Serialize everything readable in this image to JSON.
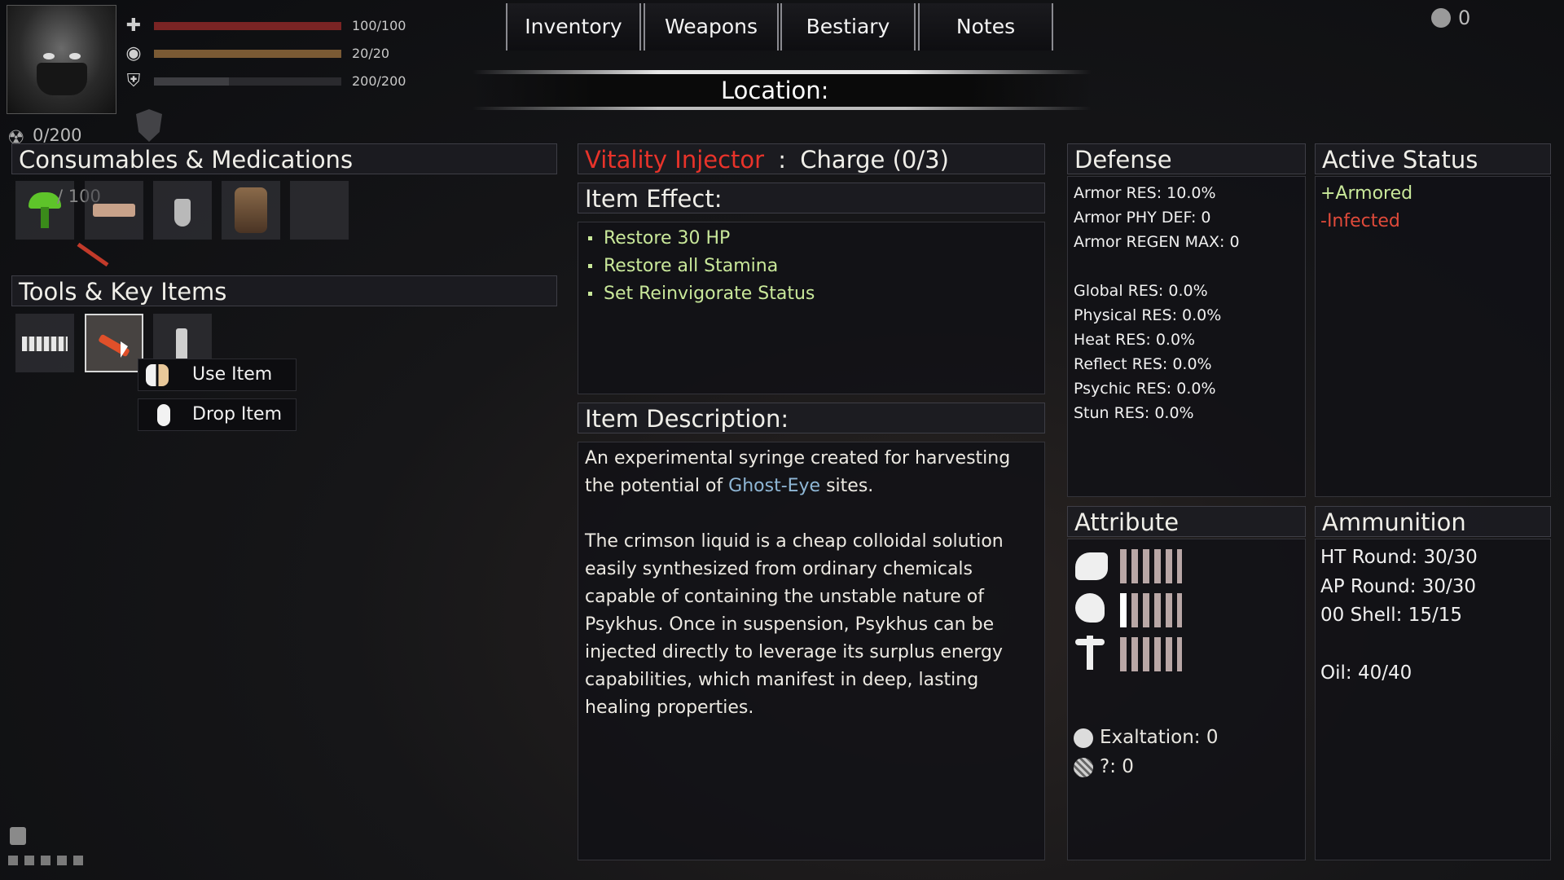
{
  "player": {
    "bars": [
      {
        "icon": "health-cross-icon",
        "value": "100/100",
        "color": "#7a2424",
        "fill": 1.0
      },
      {
        "icon": "eye-icon",
        "value": "20/20",
        "color": "#7a5a34",
        "fill": 1.0
      },
      {
        "icon": "shield-icon",
        "value": "200/200",
        "color": "#3e3e42",
        "fill": 0.4
      }
    ],
    "radiation": "0/200",
    "counter_top_right": "0"
  },
  "tabs": [
    "Inventory",
    "Weapons",
    "Bestiary",
    "Notes"
  ],
  "location_label": "Location:",
  "consumables": {
    "title": "Consumables & Medications",
    "partial_overlay": "/ 100"
  },
  "tools": {
    "title": "Tools & Key Items"
  },
  "context_menu": {
    "use": "Use Item",
    "drop": "Drop Item"
  },
  "item": {
    "name": "Vitality Injector",
    "separator": ":",
    "charge": "Charge (0/3)",
    "effect_title": "Item Effect:",
    "effects": [
      "Restore 30 HP",
      "Restore all Stamina",
      "Set Reinvigorate Status"
    ],
    "description_title": "Item Description:",
    "desc_p1_before": "An experimental syringe created for harvesting the potential of ",
    "desc_p1_highlight": "Ghost-Eye",
    "desc_p1_after": " sites.",
    "desc_p2": "The crimson liquid is a cheap colloidal solution easily synthesized from ordinary chemicals capable of containing the unstable nature of Psykhus. Once in suspension, Psykhus can be injected directly to leverage its surplus energy capabilities, which manifest in deep, lasting healing properties."
  },
  "defense": {
    "title": "Defense",
    "stats": [
      "Armor RES: 10.0%",
      "Armor PHY DEF: 0",
      "Armor REGEN MAX: 0"
    ],
    "res": [
      "Global RES: 0.0%",
      "Physical RES: 0.0%",
      "Heat RES: 0.0%",
      "Reflect RES: 0.0%",
      "Psychic RES: 0.0%",
      "Stun RES: 0.0%"
    ]
  },
  "active_status": {
    "title": "Active Status",
    "items": [
      {
        "text": "+Armored",
        "color": "#c9e89a"
      },
      {
        "text": "-Infected",
        "color": "#e04a3a"
      }
    ]
  },
  "attribute": {
    "title": "Attribute",
    "icons": [
      "strength-arm-icon",
      "brain-icon",
      "caduceus-icon"
    ],
    "exaltation": "Exaltation: 0",
    "unknown": "?: 0"
  },
  "ammunition": {
    "title": "Ammunition",
    "items": [
      "HT Round: 30/30",
      "AP Round: 30/30",
      "00 Shell: 15/15"
    ],
    "oil": "Oil: 40/40"
  },
  "colors": {
    "item_name": "#e8332a",
    "effect": "#c9e89a",
    "ghost_eye": "#8fb7d6"
  }
}
